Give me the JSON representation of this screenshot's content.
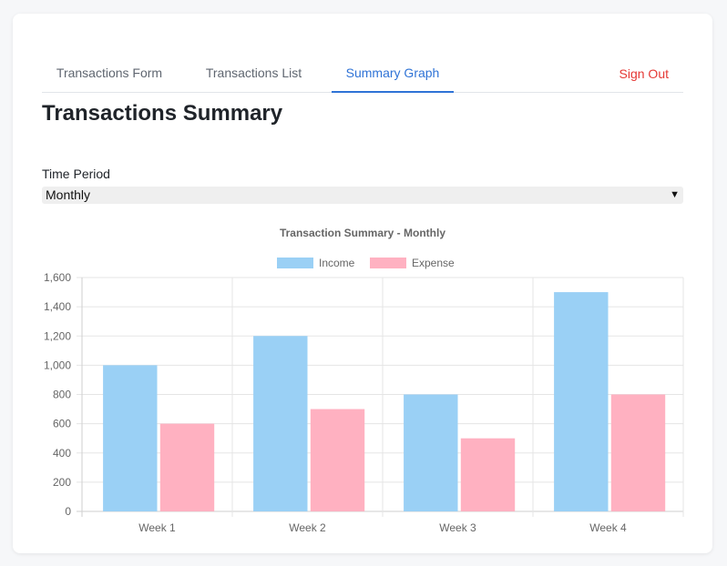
{
  "tabs": [
    {
      "label": "Transactions Form",
      "active": false
    },
    {
      "label": "Transactions List",
      "active": false
    },
    {
      "label": "Summary Graph",
      "active": true
    }
  ],
  "sign_out_label": "Sign Out",
  "page_title": "Transactions Summary",
  "time_period": {
    "label": "Time Period",
    "selected": "Monthly"
  },
  "chart_data": {
    "type": "bar",
    "title": "Transaction Summary - Monthly",
    "categories": [
      "Week 1",
      "Week 2",
      "Week 3",
      "Week 4"
    ],
    "series": [
      {
        "name": "Income",
        "values": [
          1000,
          1200,
          800,
          1500
        ],
        "color": "#9ad0f5"
      },
      {
        "name": "Expense",
        "values": [
          600,
          700,
          500,
          800
        ],
        "color": "#ffb1c1"
      }
    ],
    "ylim": [
      0,
      1600
    ],
    "yticks": [
      "0",
      "200",
      "400",
      "600",
      "800",
      "1,000",
      "1,200",
      "1,400",
      "1,600"
    ],
    "grid": true,
    "legend": "top"
  },
  "colors": {
    "accent": "#2f73d6",
    "danger": "#e53935"
  },
  "icons": {
    "select_caret": "chevron-down-icon"
  }
}
